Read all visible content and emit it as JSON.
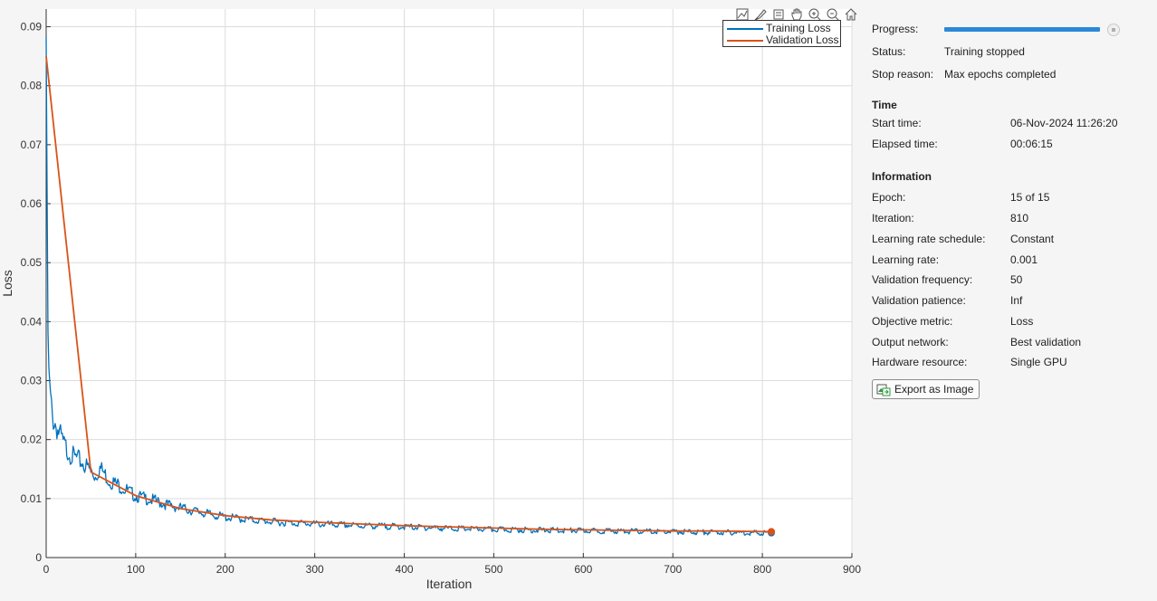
{
  "chart_data": {
    "type": "line",
    "xlabel": "Iteration",
    "ylabel": "Loss",
    "xlim": [
      0,
      900
    ],
    "ylim": [
      0,
      0.093
    ],
    "xticks": [
      "0",
      "100",
      "200",
      "300",
      "400",
      "500",
      "600",
      "700",
      "800",
      "900"
    ],
    "yticks": [
      "0",
      "0.01",
      "0.02",
      "0.03",
      "0.04",
      "0.05",
      "0.06",
      "0.07",
      "0.08",
      "0.09"
    ],
    "grid": true,
    "legend_position": "top-right",
    "series": [
      {
        "name": "Training Loss",
        "color": "#0072bd",
        "x": [
          0,
          1,
          2,
          3,
          5,
          7,
          10,
          15,
          20,
          25,
          30,
          40,
          50,
          55,
          60,
          65,
          70,
          80,
          90,
          100,
          120,
          140,
          160,
          180,
          200,
          230,
          260,
          300,
          350,
          400,
          450,
          500,
          550,
          600,
          650,
          700,
          750,
          800,
          810
        ],
        "y": [
          0.093,
          0.06,
          0.04,
          0.032,
          0.028,
          0.025,
          0.024,
          0.022,
          0.02,
          0.019,
          0.018,
          0.017,
          0.0155,
          0.0145,
          0.016,
          0.015,
          0.0138,
          0.013,
          0.012,
          0.011,
          0.0102,
          0.0092,
          0.0085,
          0.0078,
          0.0072,
          0.0067,
          0.0063,
          0.006,
          0.0057,
          0.0055,
          0.0052,
          0.005,
          0.0049,
          0.0048,
          0.0047,
          0.0046,
          0.0045,
          0.0044,
          0.0043
        ]
      },
      {
        "name": "Validation Loss",
        "color": "#d95319",
        "x": [
          0,
          50,
          100,
          150,
          200,
          250,
          300,
          350,
          400,
          450,
          500,
          550,
          600,
          650,
          700,
          750,
          800,
          810
        ],
        "y": [
          0.085,
          0.0145,
          0.0105,
          0.0083,
          0.0071,
          0.0064,
          0.006,
          0.0057,
          0.0054,
          0.0052,
          0.005,
          0.0048,
          0.0047,
          0.0046,
          0.0045,
          0.0045,
          0.0044,
          0.0044
        ]
      }
    ],
    "final_markers": [
      {
        "x": 810,
        "y": 0.0042,
        "color": "#0072bd"
      },
      {
        "x": 810,
        "y": 0.0044,
        "color": "#d95319"
      }
    ]
  },
  "toolbar": {
    "icons": [
      "data-tips-icon",
      "brush-icon",
      "restore-view-icon",
      "pan-icon",
      "zoom-in-icon",
      "zoom-out-icon",
      "home-icon"
    ]
  },
  "info": {
    "progress_label": "Progress:",
    "progress_fraction": 1.0,
    "status_label": "Status:",
    "status_value": "Training stopped",
    "stop_reason_label": "Stop reason:",
    "stop_reason_value": "Max epochs completed",
    "time_title": "Time",
    "start_time_label": "Start time:",
    "start_time_value": "06-Nov-2024 11:26:20",
    "elapsed_time_label": "Elapsed time:",
    "elapsed_time_value": "00:06:15",
    "information_title": "Information",
    "epoch_label": "Epoch:",
    "epoch_value": "15 of 15",
    "iteration_label": "Iteration:",
    "iteration_value": "810",
    "lr_schedule_label": "Learning rate schedule:",
    "lr_schedule_value": "Constant",
    "lr_label": "Learning rate:",
    "lr_value": "0.001",
    "val_freq_label": "Validation frequency:",
    "val_freq_value": "50",
    "val_patience_label": "Validation patience:",
    "val_patience_value": "Inf",
    "objective_label": "Objective metric:",
    "objective_value": "Loss",
    "output_label": "Output network:",
    "output_value": "Best validation",
    "hardware_label": "Hardware resource:",
    "hardware_value": "Single GPU",
    "export_label": "Export as Image"
  }
}
